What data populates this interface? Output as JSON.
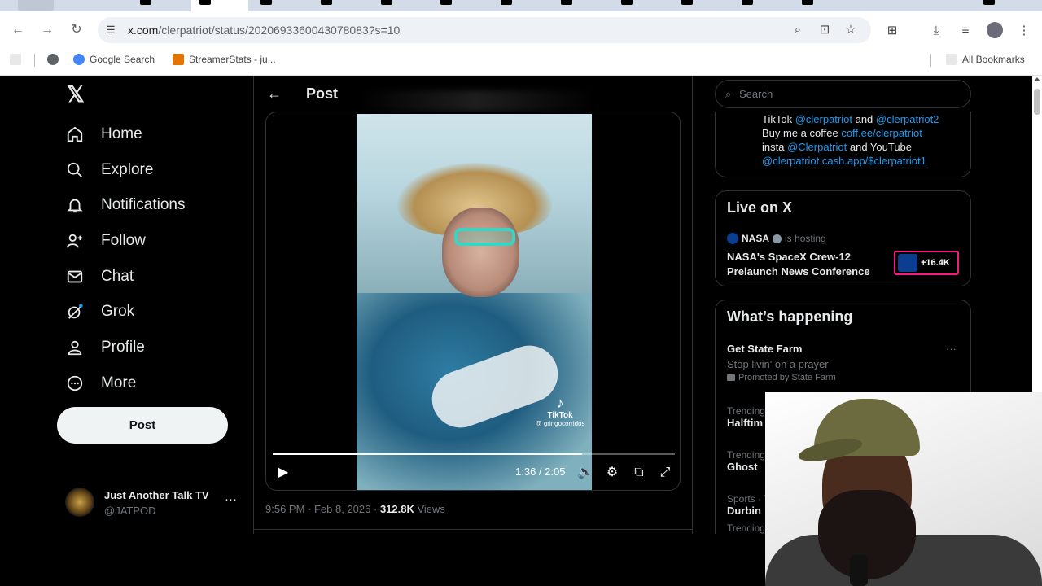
{
  "browser": {
    "url_host": "x.com",
    "url_path": "/clerpatriot/status/2020693360043078083?s=10",
    "bookmarks": [
      {
        "label": "Google Search",
        "color": "#4285f4"
      },
      {
        "label": "StreamerStats - ju...",
        "color": "#e37400"
      }
    ],
    "all_bookmarks": "All Bookmarks"
  },
  "nav": {
    "items": [
      {
        "label": "Home",
        "icon": "home-icon"
      },
      {
        "label": "Explore",
        "icon": "search-icon"
      },
      {
        "label": "Notifications",
        "icon": "bell-icon"
      },
      {
        "label": "Follow",
        "icon": "add-person-icon"
      },
      {
        "label": "Chat",
        "icon": "mail-icon"
      },
      {
        "label": "Grok",
        "icon": "grok-icon"
      },
      {
        "label": "Profile",
        "icon": "person-icon"
      },
      {
        "label": "More",
        "icon": "more-circle-icon"
      }
    ],
    "post_button": "Post",
    "account": {
      "name": "Just Another Talk TV",
      "handle": "@JATPOD"
    }
  },
  "post": {
    "header_title": "Post",
    "video": {
      "time": "1:36 / 2:05",
      "progress": 0.77,
      "watermark_brand": "TikTok",
      "watermark_user": "@ gringocorridos"
    },
    "time": "9:56 PM",
    "date": "Feb 8, 2026",
    "views_count": "312.8K",
    "views_label": "Views"
  },
  "sidebar": {
    "search_placeholder": "Search",
    "bio_lines": [
      {
        "pre": "TikTok ",
        "link": "@clerpatriot",
        "mid": " and ",
        "link2": "@clerpatriot2"
      },
      {
        "pre": "Buy me a coffee ",
        "link": "coff.ee/clerpatriot",
        "mid": "",
        "link2": ""
      },
      {
        "pre": "insta ",
        "link": "@Clerpatriot",
        "mid": " and YouTube",
        "link2": ""
      },
      {
        "pre": "",
        "link": "@clerpatriot",
        "mid": " ",
        "link2": "cash.app/$clerpatriot1"
      }
    ],
    "live": {
      "title": "Live on X",
      "host": "NASA",
      "hosting": "is hosting",
      "space_title": "NASA's SpaceX Crew-12 Prelaunch News Conference",
      "listeners": "+16.4K"
    },
    "happening": {
      "title": "What’s happening",
      "promo_title": "Get State Farm",
      "promo_sub": "Stop livin' on a prayer",
      "promo_by": "Promoted by State Farm",
      "trends": [
        {
          "meta": "Trending",
          "name": "Halftim"
        },
        {
          "meta": "Trending",
          "name": "Ghost"
        },
        {
          "meta": "Sports · T",
          "name": "Durbin"
        },
        {
          "meta": "Trending",
          "name": ""
        }
      ]
    }
  }
}
